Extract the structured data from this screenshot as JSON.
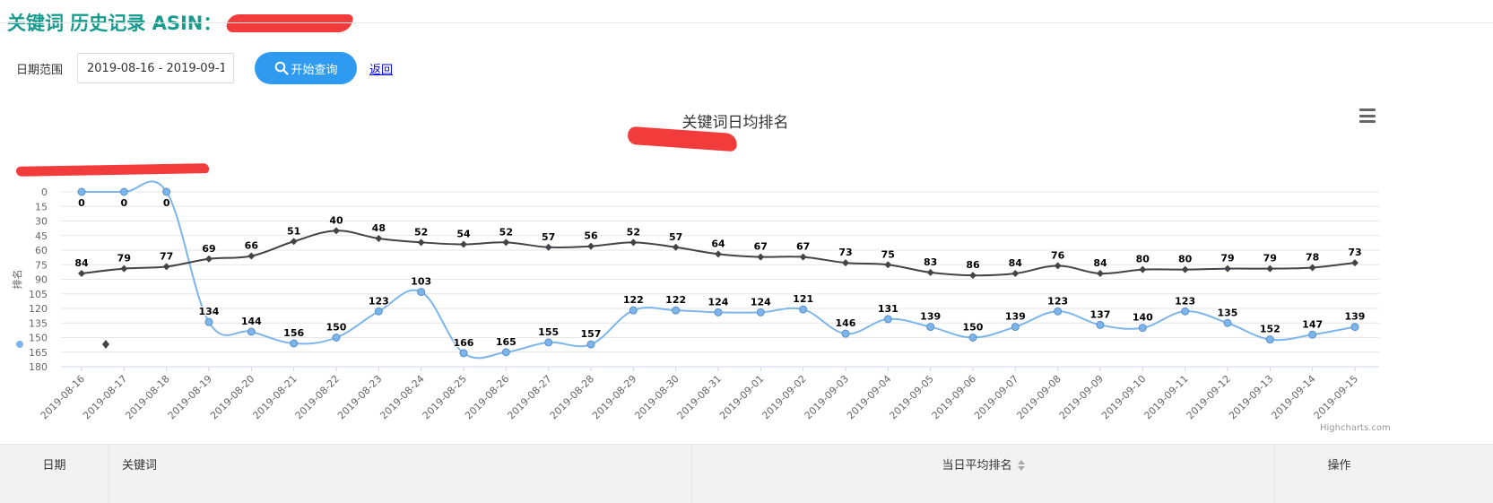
{
  "header": {
    "title": "关键词 历史记录 ASIN："
  },
  "filter": {
    "label": "日期范围",
    "date_range": "2019-08-16 - 2019-09-15",
    "query_label": "开始查询",
    "back_label": "返回"
  },
  "chart_data": {
    "type": "line",
    "title": "关键词日均排名",
    "ylabel": "排名",
    "yaxis_reversed": true,
    "ylim": [
      0,
      180
    ],
    "yticks": [
      0,
      15,
      30,
      45,
      60,
      75,
      90,
      105,
      120,
      135,
      150,
      165,
      180
    ],
    "legend_position": "top-left",
    "grid": true,
    "x": [
      "2019-08-16",
      "2019-08-17",
      "2019-08-18",
      "2019-08-19",
      "2019-08-20",
      "2019-08-21",
      "2019-08-22",
      "2019-08-23",
      "2019-08-24",
      "2019-08-25",
      "2019-08-26",
      "2019-08-27",
      "2019-08-28",
      "2019-08-29",
      "2019-08-30",
      "2019-08-31",
      "2019-09-01",
      "2019-09-02",
      "2019-09-03",
      "2019-09-04",
      "2019-09-05",
      "2019-09-06",
      "2019-09-07",
      "2019-09-08",
      "2019-09-09",
      "2019-09-10",
      "2019-09-11",
      "2019-09-12",
      "2019-09-13",
      "2019-09-14",
      "2019-09-15"
    ],
    "series": [
      {
        "color": "#7cb5ec",
        "marker": "circle",
        "values": [
          0,
          0,
          0,
          134,
          144,
          156,
          150,
          123,
          103,
          166,
          165,
          155,
          157,
          122,
          122,
          124,
          124,
          121,
          146,
          131,
          139,
          150,
          139,
          123,
          137,
          140,
          123,
          135,
          152,
          147,
          139
        ]
      },
      {
        "color": "#434348",
        "marker": "diamond",
        "values": [
          84,
          79,
          77,
          69,
          66,
          51,
          40,
          48,
          52,
          54,
          52,
          57,
          56,
          52,
          57,
          64,
          67,
          67,
          73,
          75,
          83,
          86,
          84,
          76,
          84,
          80,
          80,
          79,
          79,
          78,
          73
        ]
      }
    ],
    "credit": "Highcharts.com"
  },
  "table": {
    "headers": [
      "日期",
      "关键词",
      "当日平均排名",
      "操作"
    ]
  }
}
